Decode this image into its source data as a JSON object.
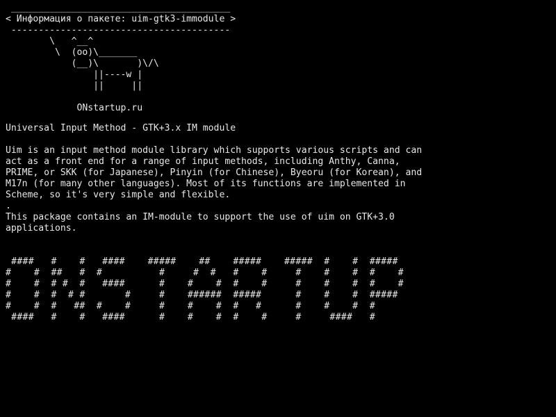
{
  "terminal": {
    "background": "#000000",
    "foreground": "#e8e8e8"
  },
  "cowsay": {
    "border_top": " ________________________________________",
    "bubble_text": "< Информация о пакете: uim-gtk3-immodule >",
    "border_bottom": " ----------------------------------------",
    "cow_lines": [
      "        \\   ^__^",
      "         \\  (oo)\\_______",
      "            (__)\\       )\\/\\",
      "                ||----w |",
      "                ||     ||"
    ],
    "blank": "",
    "signature": "             ONstartup.ru"
  },
  "package": {
    "summary": "Universal Input Method - GTK+3.x IM module",
    "description_lines": [
      "Uim is an input method module library which supports various scripts and can",
      "act as a front end for a range of input methods, including Anthy, Canna,",
      "PRIME, or SKK (for Japanese), Pinyin (for Chinese), Byeoru (for Korean), and",
      "M17n (for many other languages). Most of its functions are implemented in",
      "Scheme, so it's very simple and flexible.",
      ".",
      "This package contains an IM-module to support the use of uim on GTK+3.0",
      "applications."
    ]
  },
  "banner": {
    "text_lines": [
      " ####   #    #   ####    #####    ##    #####    #####  #    #  #####",
      "#    #  ##   #  #          #     #  #   #    #     #    #    #  #    #",
      "#    #  # #  #   ####      #    #    #  #    #     #    #    #  #    #",
      "#    #  #  # #       #     #    ######  #####      #    #    #  #####",
      "#    #  #   ##  #    #     #    #    #  #   #      #    #    #  #",
      " ####   #    #   ####      #    #    #  #    #     #     ####   #"
    ]
  }
}
